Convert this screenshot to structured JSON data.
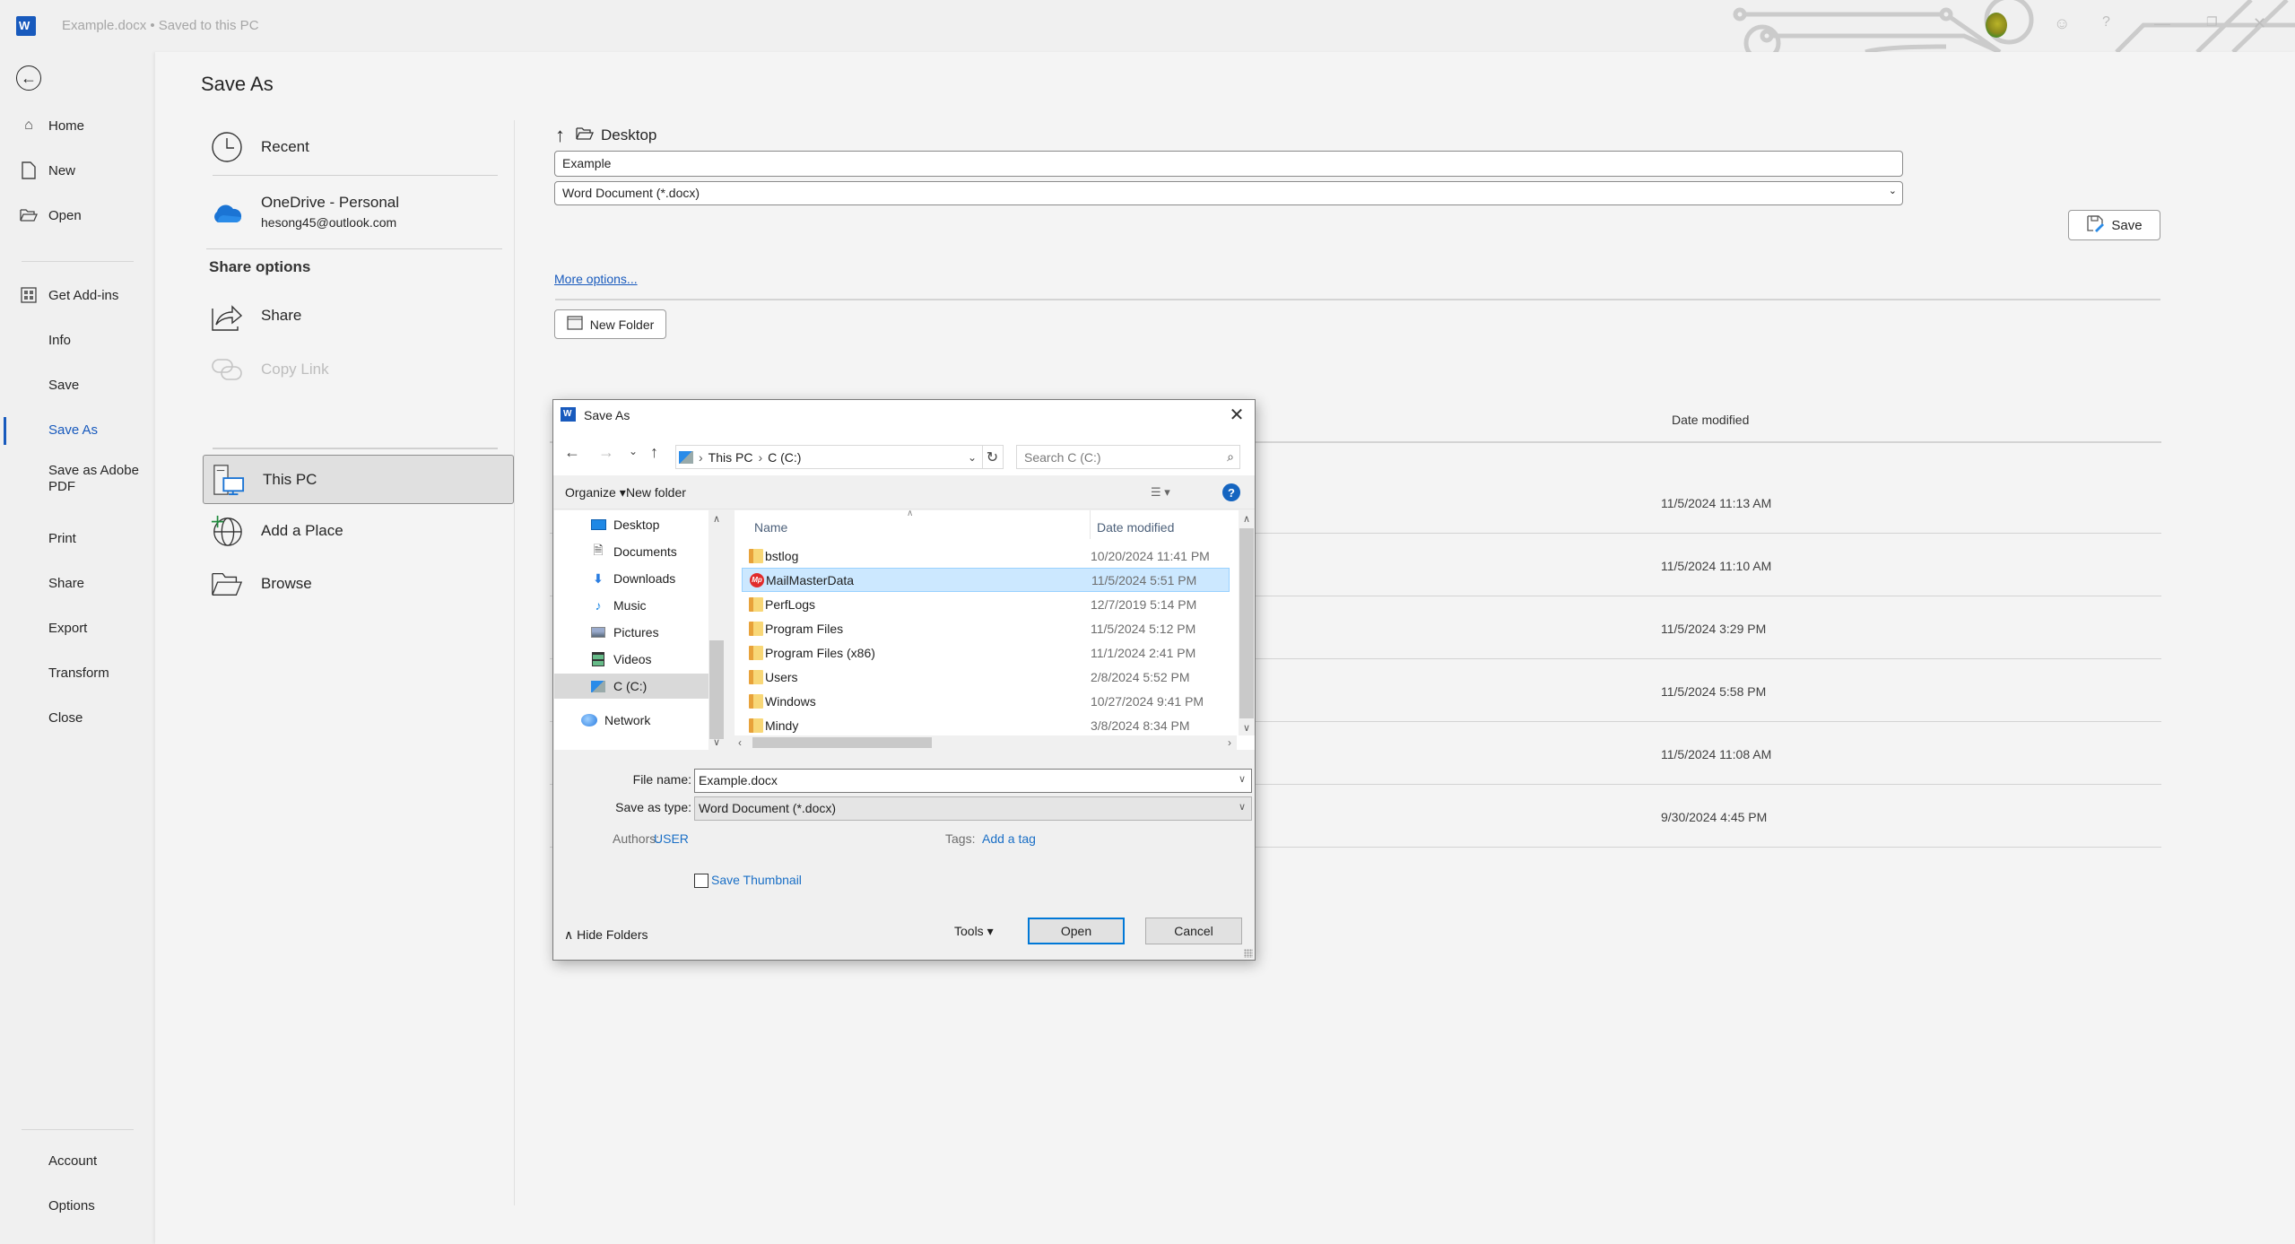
{
  "titlebar": {
    "document_title": "Example.docx • Saved to this PC",
    "app_icon": "word-icon",
    "right_icons": [
      "avatar",
      "coauthor-icon",
      "help-icon",
      "minimize-icon",
      "restore-icon",
      "close-icon"
    ],
    "help_glyph": "?",
    "minimize_glyph": "—",
    "restore_glyph": "❐",
    "close_glyph": "✕"
  },
  "leftnav": {
    "back_icon": "back-arrow-icon",
    "items": [
      {
        "label": "Home",
        "icon": "home-icon",
        "glyph": "⌂"
      },
      {
        "label": "New",
        "icon": "new-doc-icon",
        "glyph": "🗋"
      },
      {
        "label": "Open",
        "icon": "open-folder-icon",
        "glyph": "🗁"
      },
      {
        "label": "Get Add-ins",
        "icon": "add-ins-icon",
        "glyph": "⊞"
      },
      {
        "label": "Info"
      },
      {
        "label": "Save"
      },
      {
        "label": "Save As",
        "active": true
      },
      {
        "label": "Save as Adobe PDF"
      },
      {
        "label": "Print"
      },
      {
        "label": "Share"
      },
      {
        "label": "Export"
      },
      {
        "label": "Transform"
      },
      {
        "label": "Close"
      }
    ],
    "bottom_items": [
      {
        "label": "Account"
      },
      {
        "label": "Options"
      }
    ]
  },
  "main": {
    "title": "Save As",
    "locations": {
      "recent": "Recent",
      "onedrive_name": "OneDrive - Personal",
      "onedrive_email": "hesong45@outlook.com",
      "share_options_heading": "Share options",
      "share": "Share",
      "copy_link": "Copy Link",
      "this_pc": "This PC",
      "add_a_place": "Add a Place",
      "browse": "Browse"
    },
    "current_folder": "Desktop",
    "file_name_value": "Example",
    "file_type_value": "Word Document (*.docx)",
    "save_button": "Save",
    "more_options": "More options...",
    "new_folder_button": "New Folder",
    "list_header_date": "Date modified",
    "list_dates": [
      "11/5/2024 11:13 AM",
      "11/5/2024 11:10 AM",
      "11/5/2024 3:29 PM",
      "11/5/2024 5:58 PM",
      "11/5/2024 11:08 AM",
      "9/30/2024 4:45 PM"
    ]
  },
  "dialog": {
    "title": "Save As",
    "close_glyph": "✕",
    "nav": {
      "back": "←",
      "forward": "→",
      "recent": "⌄",
      "up": "↑"
    },
    "breadcrumb": [
      "This PC",
      "C (C:)"
    ],
    "breadcrumb_sep": "›",
    "search_placeholder": "Search C (C:)",
    "toolbar": {
      "organize": "Organize ▾",
      "new_folder": "New folder",
      "help": "?"
    },
    "tree": [
      {
        "label": "Desktop",
        "icon": "desktop-icon"
      },
      {
        "label": "Documents",
        "icon": "documents-icon"
      },
      {
        "label": "Downloads",
        "icon": "downloads-icon"
      },
      {
        "label": "Music",
        "icon": "music-icon"
      },
      {
        "label": "Pictures",
        "icon": "pictures-icon"
      },
      {
        "label": "Videos",
        "icon": "videos-icon"
      },
      {
        "label": "C (C:)",
        "icon": "drive-icon",
        "selected": true
      },
      {
        "label": "Network",
        "icon": "network-icon"
      }
    ],
    "columns": {
      "name": "Name",
      "date": "Date modified"
    },
    "files": [
      {
        "name": "bstlog",
        "date": "10/20/2024 11:41 PM",
        "icon": "folder"
      },
      {
        "name": "MailMasterData",
        "date": "11/5/2024 5:51 PM",
        "icon": "mailmaster",
        "selected": true
      },
      {
        "name": "PerfLogs",
        "date": "12/7/2019 5:14 PM",
        "icon": "folder"
      },
      {
        "name": "Program Files",
        "date": "11/5/2024 5:12 PM",
        "icon": "folder"
      },
      {
        "name": "Program Files (x86)",
        "date": "11/1/2024 2:41 PM",
        "icon": "folder"
      },
      {
        "name": "Users",
        "date": "2/8/2024 5:52 PM",
        "icon": "folder"
      },
      {
        "name": "Windows",
        "date": "10/27/2024 9:41 PM",
        "icon": "folder"
      },
      {
        "name": "Mindy",
        "date": "3/8/2024 8:34 PM",
        "icon": "folder"
      }
    ],
    "file_name_label": "File name:",
    "file_name_value": "Example.docx",
    "save_type_label": "Save as type:",
    "save_type_value": "Word Document (*.docx)",
    "authors_label": "Authors:",
    "authors_value": "USER",
    "tags_label": "Tags:",
    "tags_value": "Add a tag",
    "save_thumbnail_label": "Save Thumbnail",
    "save_thumbnail_checked": false,
    "hide_folders": "∧  Hide Folders",
    "tools": "Tools  ▾",
    "open_button": "Open",
    "cancel_button": "Cancel"
  }
}
